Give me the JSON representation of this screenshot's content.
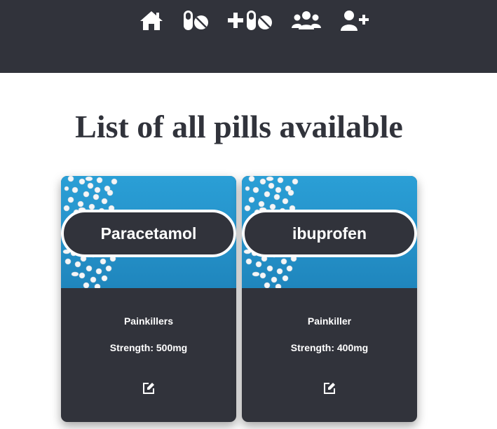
{
  "nav": {
    "icons": [
      "home-icon",
      "pills-icon",
      "add-pill-icon",
      "users-icon",
      "add-user-icon"
    ]
  },
  "page": {
    "title": "List of all pills available"
  },
  "pills": [
    {
      "name": "Paracetamol",
      "type": "Painkillers",
      "strength": "Strength: 500mg",
      "edit_icon": "edit-icon"
    },
    {
      "name": "ibuprofen",
      "type": "Painkiller",
      "strength": "Strength: 400mg",
      "edit_icon": "edit-icon"
    }
  ],
  "colors": {
    "navbar": "#31333b",
    "card": "#31333b",
    "title": "#31333b",
    "card_image": "#2a9fd6",
    "text_light": "#ffffff"
  }
}
